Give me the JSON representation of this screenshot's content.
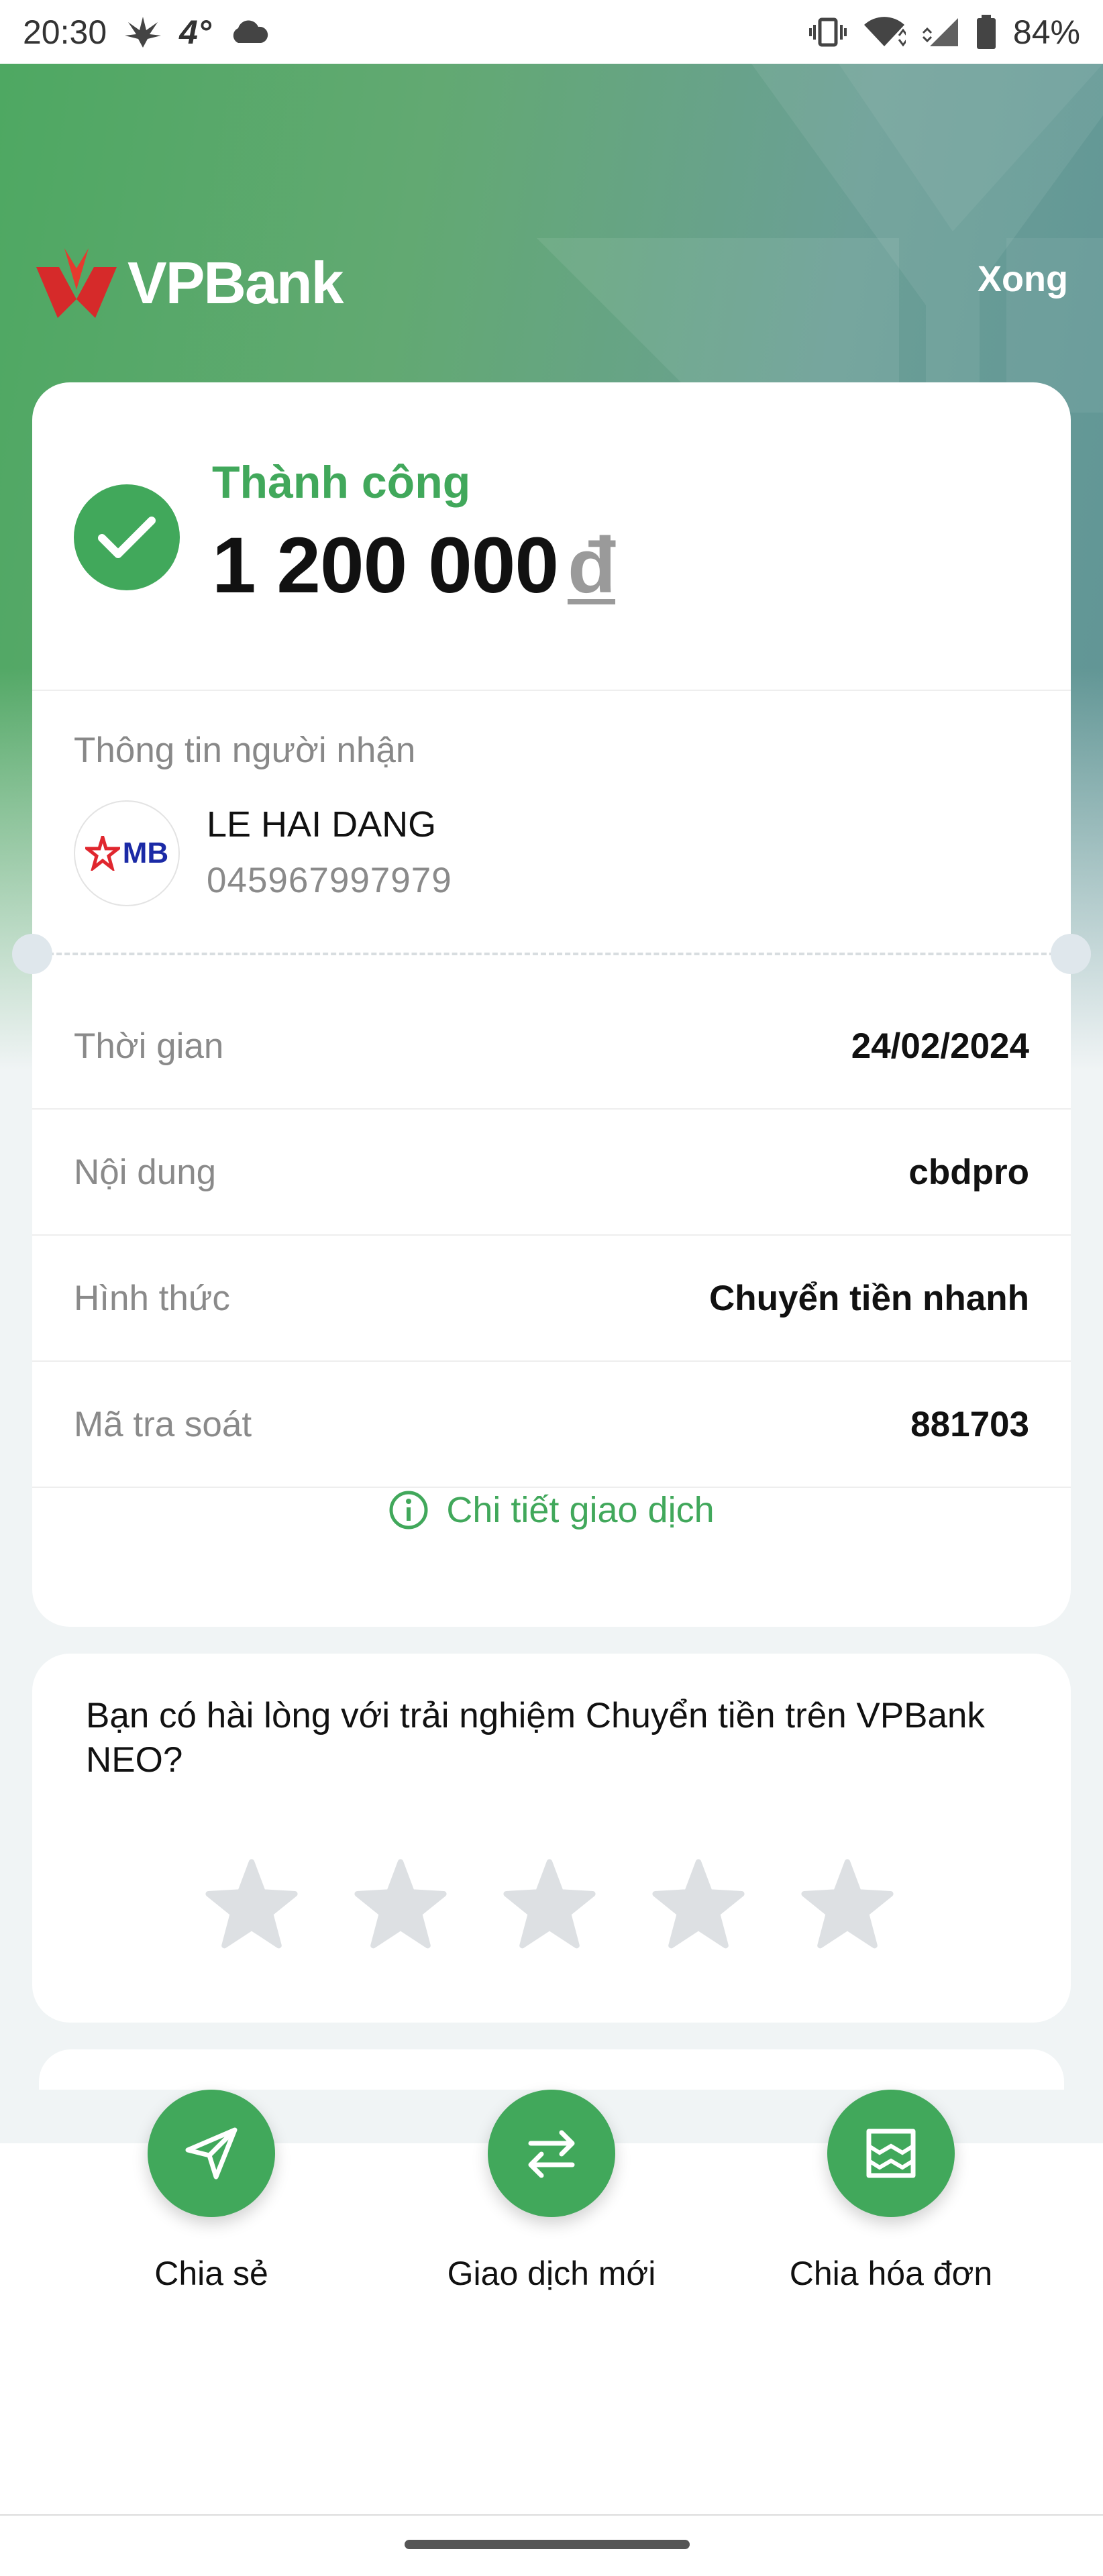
{
  "status_bar": {
    "time": "20:30",
    "temperature": "4°",
    "battery": "84%",
    "icons": [
      "cannabis-leaf-icon",
      "cloud-icon",
      "vibrate-icon",
      "wifi-icon",
      "signal-icon",
      "battery-icon"
    ]
  },
  "header": {
    "brand": "VPBank",
    "done_label": "Xong"
  },
  "transaction": {
    "status": "Thành công",
    "amount": "1 200 000",
    "currency": "đ",
    "recipient_label": "Thông tin người nhận",
    "recipient_bank": "MB",
    "recipient_name": "LE HAI DANG",
    "recipient_account": "045967997979",
    "rows": [
      {
        "label": "Thời gian",
        "value": "24/02/2024"
      },
      {
        "label": "Nội dung",
        "value": "cbdpro"
      },
      {
        "label": "Hình thức",
        "value": "Chuyển tiền nhanh"
      },
      {
        "label": "Mã tra soát",
        "value": "881703"
      }
    ],
    "detail_link": "Chi tiết giao dịch"
  },
  "rating": {
    "question": "Bạn có hài lòng với trải nghiệm Chuyển tiền trên VPBank NEO?",
    "star_count": 5,
    "selected": 0
  },
  "actions": [
    {
      "label": "Chia sẻ",
      "icon": "send-icon"
    },
    {
      "label": "Giao dịch mới",
      "icon": "swap-arrows-icon"
    },
    {
      "label": "Chia hóa đơn",
      "icon": "receipt-split-icon"
    }
  ],
  "colors": {
    "accent_green": "#41a85b",
    "header_green": "#4ea862",
    "header_teal": "#5a8f95",
    "muted_text": "#8a8a8a",
    "star_gray": "#dde0e3"
  }
}
